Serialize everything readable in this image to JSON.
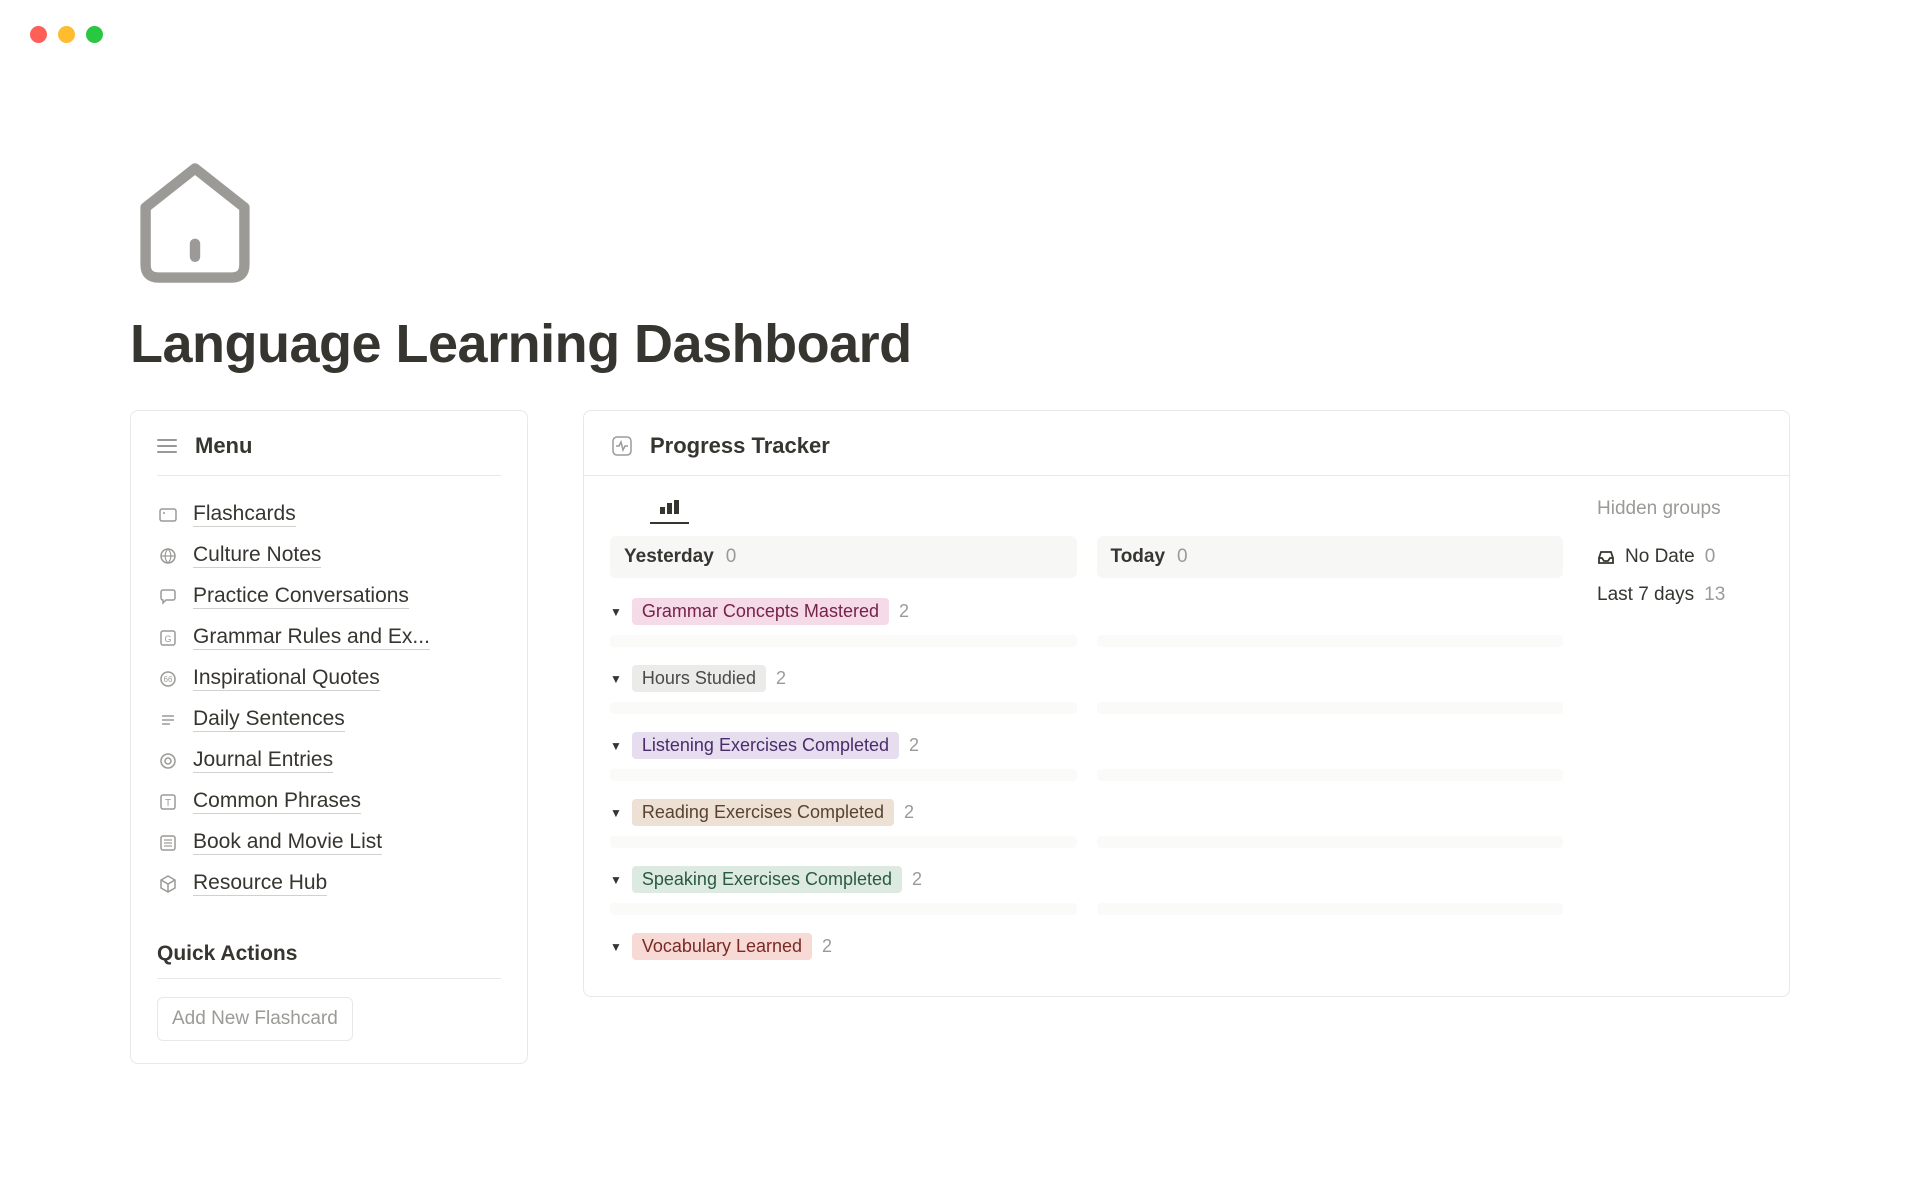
{
  "page": {
    "title": "Language Learning Dashboard"
  },
  "sidebar": {
    "menu_title": "Menu",
    "items": [
      {
        "label": "Flashcards",
        "icon": "card-icon"
      },
      {
        "label": "Culture Notes",
        "icon": "globe-note-icon"
      },
      {
        "label": "Practice Conversations",
        "icon": "chat-icon"
      },
      {
        "label": "Grammar Rules and Ex...",
        "icon": "grammar-icon"
      },
      {
        "label": "Inspirational Quotes",
        "icon": "quote-icon"
      },
      {
        "label": "Daily Sentences",
        "icon": "lines-icon"
      },
      {
        "label": "Journal Entries",
        "icon": "journal-icon"
      },
      {
        "label": "Common Phrases",
        "icon": "text-icon"
      },
      {
        "label": "Book and Movie List",
        "icon": "list-icon"
      },
      {
        "label": "Resource Hub",
        "icon": "cube-icon"
      }
    ],
    "quick_actions_title": "Quick Actions",
    "quick_actions": [
      {
        "label": "Add New Flashcard"
      }
    ]
  },
  "tracker": {
    "title": "Progress Tracker",
    "columns": [
      {
        "title": "Yesterday",
        "count": "0"
      },
      {
        "title": "Today",
        "count": "0"
      }
    ],
    "categories": [
      {
        "label": "Grammar Concepts Mastered",
        "count": "2",
        "color": "pink"
      },
      {
        "label": "Hours Studied",
        "count": "2",
        "color": "gray"
      },
      {
        "label": "Listening Exercises Completed",
        "count": "2",
        "color": "purple"
      },
      {
        "label": "Reading Exercises Completed",
        "count": "2",
        "color": "brown"
      },
      {
        "label": "Speaking Exercises Completed",
        "count": "2",
        "color": "green"
      },
      {
        "label": "Vocabulary Learned",
        "count": "2",
        "color": "red"
      }
    ],
    "hidden_groups": {
      "title": "Hidden groups",
      "rows": [
        {
          "label": "No Date",
          "count": "0",
          "has_icon": true
        },
        {
          "label": "Last 7 days",
          "count": "13",
          "has_icon": false
        }
      ]
    }
  }
}
